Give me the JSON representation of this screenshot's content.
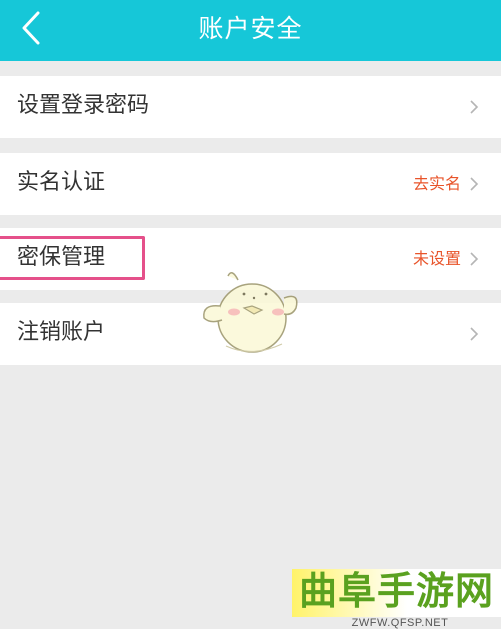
{
  "header": {
    "title": "账户安全",
    "back_icon": "chevron-left-icon",
    "background": "#16c7d8"
  },
  "rows": [
    {
      "label": "设置登录密码",
      "value": ""
    },
    {
      "label": "实名认证",
      "value": "去实名"
    },
    {
      "label": "密保管理",
      "value": "未设置"
    },
    {
      "label": "注销账户",
      "value": ""
    }
  ],
  "colors": {
    "status_text": "#e8542a",
    "highlight": "#e5508a"
  },
  "watermark": {
    "title": "曲阜手游网",
    "url": "ZWFW.QFSP.NET"
  }
}
